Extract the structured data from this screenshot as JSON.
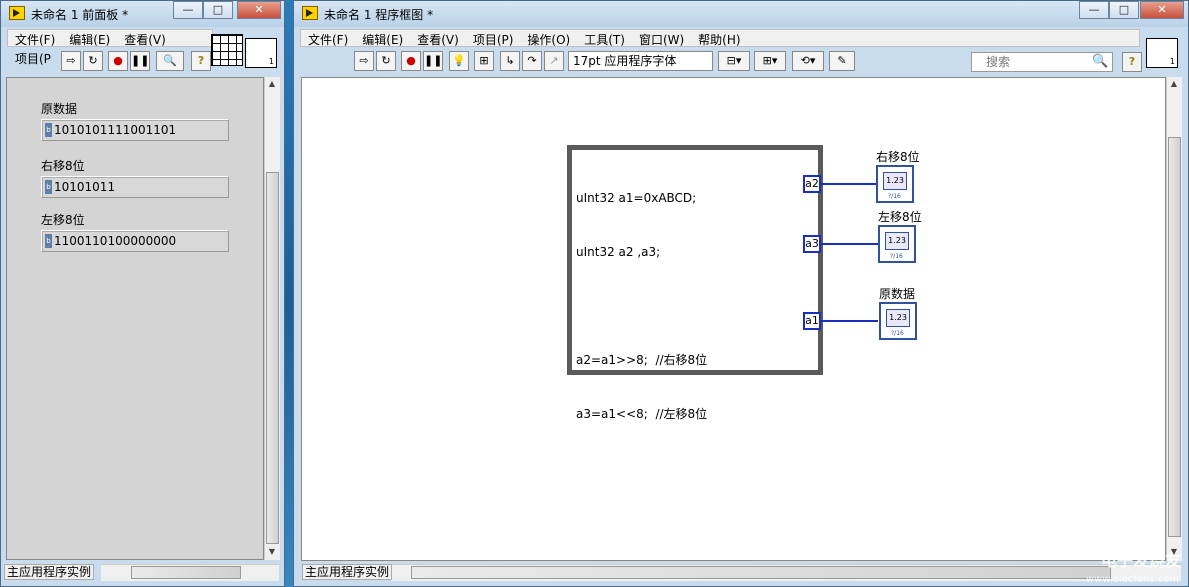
{
  "front_panel": {
    "title": "未命名 1 前面板 *",
    "menus": [
      "文件(F)",
      "编辑(E)",
      "查看(V)",
      "项目(P"
    ],
    "indicators": [
      {
        "label": "原数据",
        "value": "1010101111001101"
      },
      {
        "label": "右移8位",
        "value": "10101011"
      },
      {
        "label": "左移8位",
        "value": "1100110100000000"
      }
    ],
    "status": "主应用程序实例"
  },
  "block_diagram": {
    "title": "未命名 1 程序框图 *",
    "menus": [
      "文件(F)",
      "编辑(E)",
      "查看(V)",
      "项目(P)",
      "操作(O)",
      "工具(T)",
      "窗口(W)",
      "帮助(H)"
    ],
    "font_select": "17pt 应用程序字体",
    "search_placeholder": "搜索",
    "formula_lines": [
      "uInt32 a1=0xABCD;",
      "uInt32 a2 ,a3;",
      "",
      "a2=a1>>8;  //右移8位",
      "a3=a1<<8;  //左移8位"
    ],
    "terminals": [
      "a2",
      "a3",
      "a1"
    ],
    "nodes": [
      {
        "label": "右移8位",
        "icon_text": "1.23",
        "tag": "?/16"
      },
      {
        "label": "左移8位",
        "icon_text": "1.23",
        "tag": "?/16"
      },
      {
        "label": "原数据",
        "icon_text": "1.23",
        "tag": "?/16"
      }
    ],
    "status": "主应用程序实例"
  },
  "watermark": {
    "main": "电子发烧友",
    "sub": "www.elecfans.com"
  },
  "colors": {
    "wire": "#1a2fbf",
    "title_bg": "#c9dced",
    "panel_bg": "#d4d4d4"
  }
}
